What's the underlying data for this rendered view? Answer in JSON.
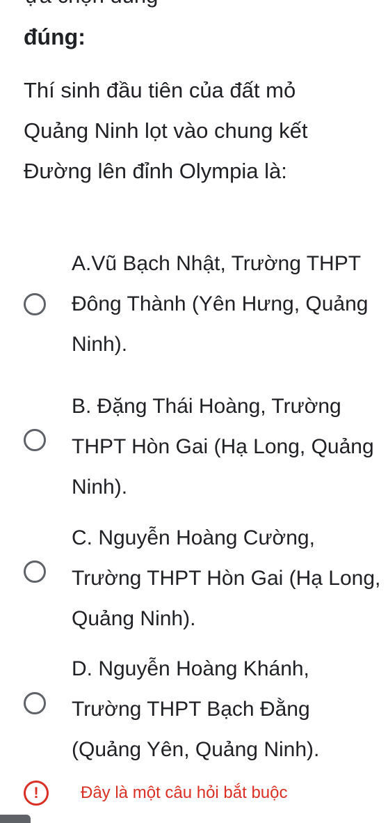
{
  "question": {
    "title": "đúng:",
    "text": "Thí sinh đầu tiên của đất mỏ Quảng Ninh lọt vào chung kết Đường lên đỉnh Olympia là:"
  },
  "options": [
    {
      "label": "A.Vũ Bạch Nhật, Trường THPT Đông Thành (Yên Hưng, Quảng Ninh)."
    },
    {
      "label": "B. Đặng Thái Hoàng, Trường THPT Hòn Gai (Hạ Long, Quảng Ninh)."
    },
    {
      "label": "C. Nguyễn Hoàng Cường, Trường THPT Hòn Gai (Hạ Long, Quảng Ninh)."
    },
    {
      "label": "D. Nguyễn Hoàng Khánh, Trường THPT Bạch Đằng (Quảng Yên, Quảng Ninh)."
    }
  ],
  "required_notice": {
    "icon": "!",
    "text": "Đây là một câu hỏi bắt buộc"
  },
  "colors": {
    "error": "#d93025",
    "radio_border": "#5f6368",
    "text": "#202124"
  }
}
